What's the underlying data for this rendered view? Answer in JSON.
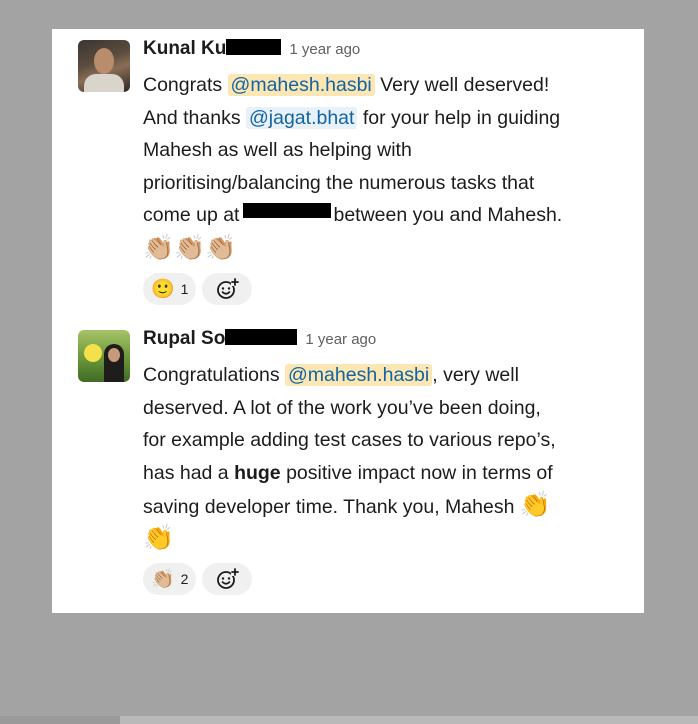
{
  "messages": [
    {
      "author": "Kunal Ku",
      "time": "1 year ago",
      "lines": [
        [
          "Congrats ",
          "@mahesh.hasbi",
          " Very well deserved!"
        ],
        [
          "And thanks ",
          "@jagat.bhat",
          " for your help in guiding"
        ],
        [
          "Mahesh as well as helping with"
        ],
        [
          "prioritising/balancing the numerous tasks that"
        ],
        [
          "come up at",
          "between you and Mahesh."
        ]
      ],
      "emoji_line": "👏🏼👏🏼👏🏼",
      "reactions": [
        {
          "emoji": "🙂",
          "count": "1"
        }
      ]
    },
    {
      "author": "Rupal So",
      "time": "1 year ago",
      "lines": [
        [
          "Congratulations ",
          "@mahesh.hasbi",
          ", very well"
        ],
        [
          "deserved. A lot of the work you’ve been doing,"
        ],
        [
          "for example adding test cases to various repo’s,"
        ],
        [
          "has had a ",
          "huge",
          " positive impact now in terms of"
        ],
        [
          "saving developer time. Thank you, Mahesh ",
          "👏"
        ]
      ],
      "emoji_line": "👏",
      "reactions": [
        {
          "emoji": "👏🏼",
          "count": "2"
        }
      ]
    }
  ],
  "icons": {
    "add_reaction": "add-reaction-icon"
  }
}
